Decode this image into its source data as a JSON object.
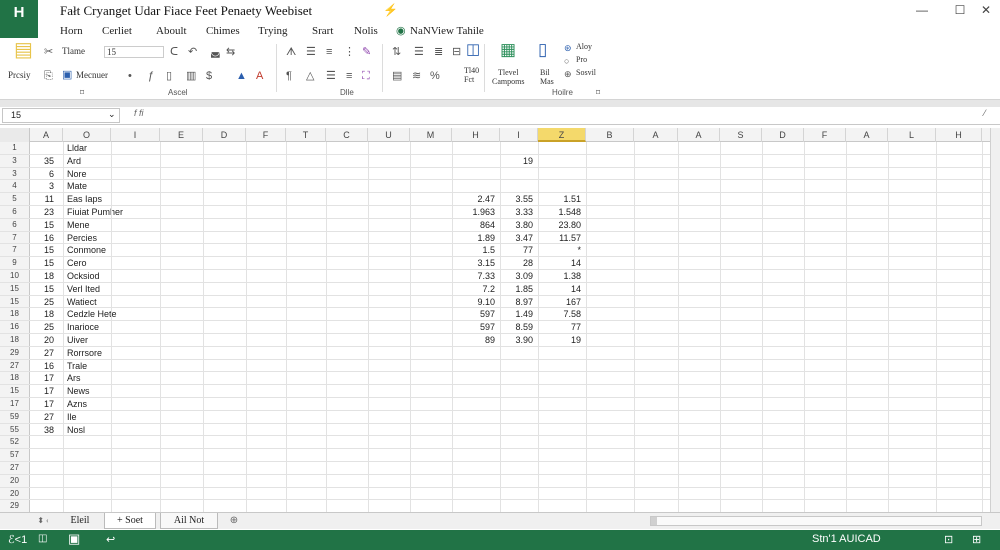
{
  "app": {
    "logo": "H",
    "title": "Fałt Cryanget   Udar   Fiace   Feet     Penaety     Weebiset"
  },
  "window": {
    "minimize": "—",
    "maximize": "☐",
    "close": "✕"
  },
  "menu": [
    "Horn",
    "Cerliet",
    "Aboult",
    "Chimes",
    "Trying",
    "Srart",
    "Nolis",
    "NaNView Tahile"
  ],
  "ribbon": {
    "paste": "Prcsiy",
    "font_name": "Tlame",
    "font_size": "15",
    "format_painter": "Mecnuer",
    "group_font": "Ascel",
    "group_table": "Dlle",
    "group_kisinte": "Hoilre",
    "table_btn": "Tl40\nFct",
    "compounds": "Tlevel\nCampoms",
    "bit_max": "Bil\nMas",
    "ri_items": [
      "Aloy",
      "Pro",
      "Sosvil"
    ]
  },
  "formula_bar": {
    "name_box": "15",
    "fx": "f fi",
    "value": ""
  },
  "columns": [
    "A",
    "O",
    "I",
    "E",
    "D",
    "F",
    "T",
    "C",
    "U",
    "M",
    "H",
    "I",
    "Z",
    "B",
    "A",
    "A",
    "S",
    "D",
    "F",
    "A",
    "L",
    "H"
  ],
  "selected_column": 12,
  "rows": [
    {
      "n": "1",
      "a": "",
      "b": "Lldar",
      "h": "",
      "i": "",
      "z": ""
    },
    {
      "n": "3",
      "a": "35",
      "b": "Ard",
      "h": "",
      "i": "19",
      "z": ""
    },
    {
      "n": "3",
      "a": "6",
      "b": "Nore",
      "h": "",
      "i": "",
      "z": ""
    },
    {
      "n": "4",
      "a": "3",
      "b": "Mate",
      "h": "",
      "i": "",
      "z": ""
    },
    {
      "n": "5",
      "a": "11",
      "b": "Eas Iaps",
      "h": "2.47",
      "i": "3.55",
      "z": "1.51"
    },
    {
      "n": "6",
      "a": "23",
      "b": "Fiuiat Pumher",
      "h": "1.963",
      "i": "3.33",
      "z": "1.548"
    },
    {
      "n": "6",
      "a": "15",
      "b": "Mene",
      "h": "864",
      "i": "3.80",
      "z": "23.80"
    },
    {
      "n": "7",
      "a": "16",
      "b": "Percies",
      "h": "1.89",
      "i": "3.47",
      "z": "11.57"
    },
    {
      "n": "7",
      "a": "15",
      "b": "Conmone",
      "h": "1.5",
      "i": "77",
      "z": "*"
    },
    {
      "n": "9",
      "a": "15",
      "b": "Cero",
      "h": "3.15",
      "i": "28",
      "z": "14"
    },
    {
      "n": "10",
      "a": "18",
      "b": "Ocksiod",
      "h": "7.33",
      "i": "3.09",
      "z": "1.38"
    },
    {
      "n": "15",
      "a": "15",
      "b": "Verl Ited",
      "h": "7.2",
      "i": "1.85",
      "z": "14"
    },
    {
      "n": "15",
      "a": "25",
      "b": "Watiect",
      "h": "9.10",
      "i": "8.97",
      "z": "167"
    },
    {
      "n": "18",
      "a": "18",
      "b": "Cedzle Hete",
      "h": "597",
      "i": "1.49",
      "z": "7.58"
    },
    {
      "n": "16",
      "a": "25",
      "b": "Inarioce",
      "h": "597",
      "i": "8.59",
      "z": "77"
    },
    {
      "n": "18",
      "a": "20",
      "b": "Uiver",
      "h": "89",
      "i": "3.90",
      "z": "19"
    },
    {
      "n": "29",
      "a": "27",
      "b": "Rorrsore",
      "h": "",
      "i": "",
      "z": ""
    },
    {
      "n": "27",
      "a": "16",
      "b": "Trale",
      "h": "",
      "i": "",
      "z": ""
    },
    {
      "n": "18",
      "a": "17",
      "b": "Ars",
      "h": "",
      "i": "",
      "z": ""
    },
    {
      "n": "15",
      "a": "17",
      "b": "News",
      "h": "",
      "i": "",
      "z": ""
    },
    {
      "n": "17",
      "a": "17",
      "b": "Azns",
      "h": "",
      "i": "",
      "z": ""
    },
    {
      "n": "59",
      "a": "27",
      "b": "Ile",
      "h": "",
      "i": "",
      "z": ""
    },
    {
      "n": "55",
      "a": "38",
      "b": "Nosl",
      "h": "",
      "i": "",
      "z": ""
    },
    {
      "n": "52",
      "a": "",
      "b": "",
      "h": "",
      "i": "",
      "z": ""
    },
    {
      "n": "57",
      "a": "",
      "b": "",
      "h": "",
      "i": "",
      "z": ""
    },
    {
      "n": "27",
      "a": "",
      "b": "",
      "h": "",
      "i": "",
      "z": ""
    },
    {
      "n": "20",
      "a": "",
      "b": "",
      "h": "",
      "i": "",
      "z": ""
    },
    {
      "n": "20",
      "a": "",
      "b": "",
      "h": "",
      "i": "",
      "z": ""
    },
    {
      "n": "29",
      "a": "",
      "b": "",
      "h": "",
      "i": "",
      "z": ""
    }
  ],
  "sheets": {
    "prev": "⬍ ‹",
    "tab1": "Eleil",
    "tab2": "+ Soet",
    "tab3": "Ail Not",
    "add": "⊕"
  },
  "status": {
    "left": "ℰ<1",
    "mode": "Stn'1  AUICAD"
  }
}
